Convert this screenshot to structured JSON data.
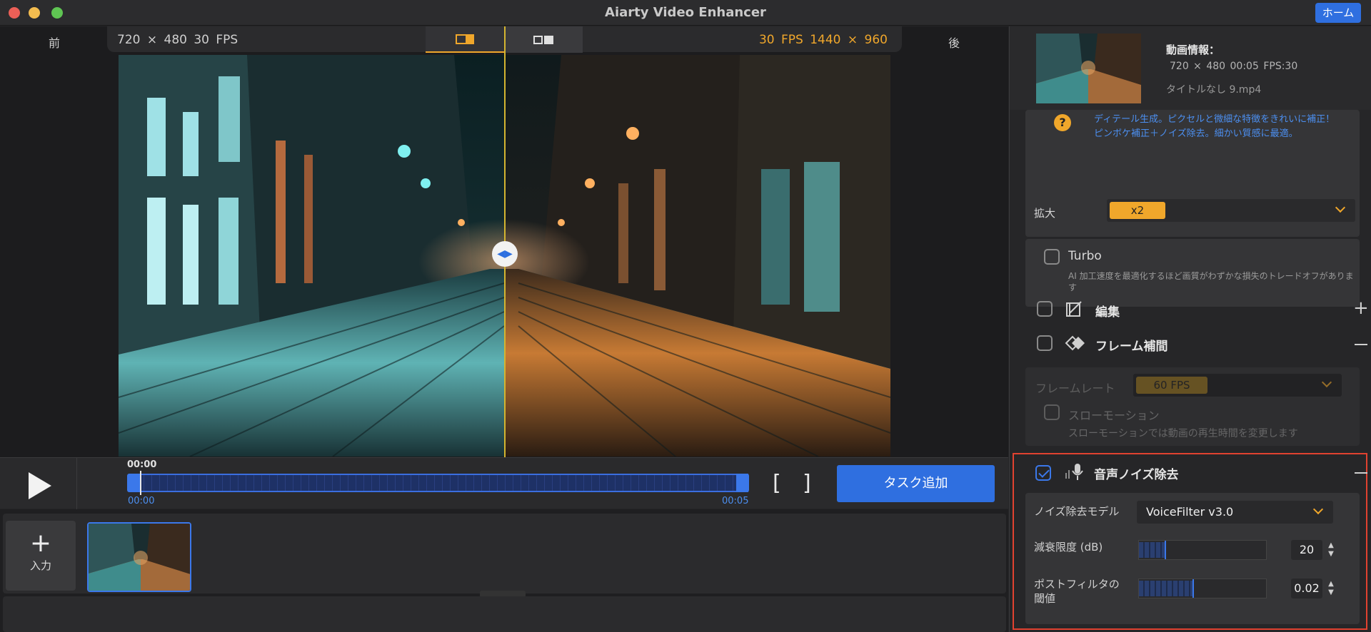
{
  "window": {
    "title": "Aiarty Video Enhancer",
    "home_button": "ホーム"
  },
  "preview": {
    "before_label": "前",
    "after_label": "後",
    "source_info": "720 × 480   30 FPS",
    "output_info": "30 FPS   1440 × 960"
  },
  "playback": {
    "current_time": "00:00",
    "start_time": "00:00",
    "end_time": "00:05",
    "add_task_label": "タスク追加"
  },
  "queue": {
    "input_label": "入力"
  },
  "video_info": {
    "title": "動画情報：",
    "spec": "720 × 480 00:05 FPS:30",
    "filename": "タイトルなし 9.mp4"
  },
  "enhance": {
    "desc_line1": "ディテール生成。ピクセルと微細な特徴をきれいに補正！",
    "desc_line2": "ピンボケ補正＋ノイズ除去。細かい質感に最適。",
    "zoom_label": "拡大",
    "zoom_value": "x2",
    "turbo_label": "Turbo",
    "turbo_desc": "AI 加工速度を最適化するほど画質がわずかな損失のトレードオフがあります"
  },
  "edit": {
    "title": "編集",
    "enabled": false
  },
  "frame_interp": {
    "title": "フレーム補間",
    "enabled": false,
    "rate_label": "フレームレート",
    "rate_value": "60 FPS",
    "slowmo_label": "スローモーション",
    "slowmo_desc": "スローモーションでは動画の再生時間を変更します"
  },
  "audio_denoise": {
    "title": "音声ノイズ除去",
    "enabled": true,
    "model_label": "ノイズ除去モデル",
    "model_value": "VoiceFilter v3.0",
    "atten_label": "減衰限度 (dB)",
    "atten_value": "20",
    "atten_fraction": 0.2,
    "post_label_line1": "ポストフィルタの",
    "post_label_line2": "閾値",
    "post_value": "0.02",
    "post_fraction": 0.42
  },
  "colors": {
    "accent_blue": "#2f6fe0",
    "accent_orange": "#f0a72b",
    "highlight_red": "#e14230"
  }
}
